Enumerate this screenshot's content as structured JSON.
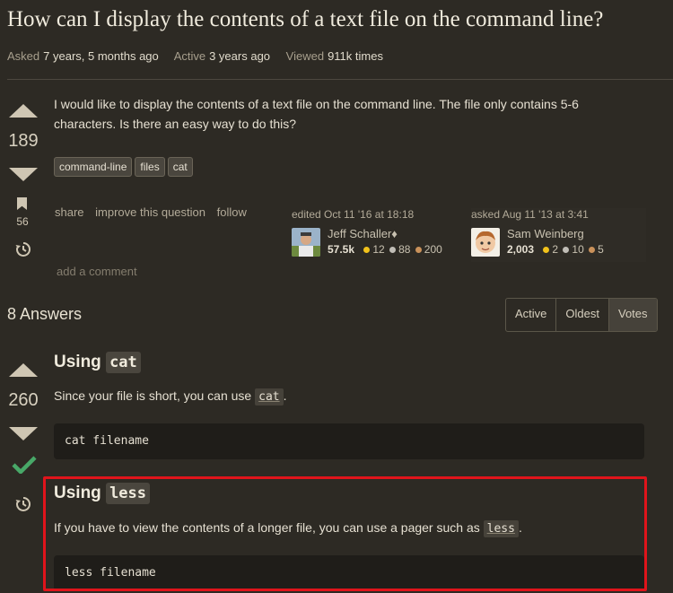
{
  "question": {
    "title": "How can I display the contents of a text file on the command line?",
    "asked_label": "Asked",
    "asked_value": "7 years, 5 months ago",
    "active_label": "Active",
    "active_value": "3 years ago",
    "viewed_label": "Viewed",
    "viewed_value": "911k times",
    "votes": "189",
    "bookmarks": "56",
    "body": "I would like to display the contents of a text file on the command line. The file only contains 5-6 characters. Is there an easy way to do this?",
    "tags": [
      "command-line",
      "files",
      "cat"
    ],
    "menu": {
      "share": "share",
      "improve": "improve this question",
      "follow": "follow"
    },
    "editor": {
      "timestamp": "edited Oct 11 '16 at 18:18",
      "name": "Jeff Schaller",
      "mod": "♦",
      "rep": "57.5k",
      "gold": "12",
      "silver": "88",
      "bronze": "200"
    },
    "asker": {
      "timestamp": "asked Aug 11 '13 at 3:41",
      "name": "Sam Weinberg",
      "rep": "2,003",
      "gold": "2",
      "silver": "10",
      "bronze": "5"
    },
    "add_comment": "add a comment"
  },
  "answers": {
    "heading": "8 Answers",
    "sort_tabs": [
      "Active",
      "Oldest",
      "Votes"
    ],
    "first": {
      "votes": "260",
      "h1_prefix": "Using",
      "h1_code": "cat",
      "p1_text": "Since your file is short, you can use",
      "p1_code": "cat",
      "p1_end": ".",
      "code1": "cat filename",
      "h2_prefix": "Using",
      "h2_code": "less",
      "p2_text": "If you have to view the contents of a longer file, you can use a pager such as",
      "p2_code": "less",
      "p2_end": ".",
      "code2": "less filename"
    }
  },
  "colors": {
    "accepted": "#48a868",
    "highlight": "#e0141b"
  }
}
